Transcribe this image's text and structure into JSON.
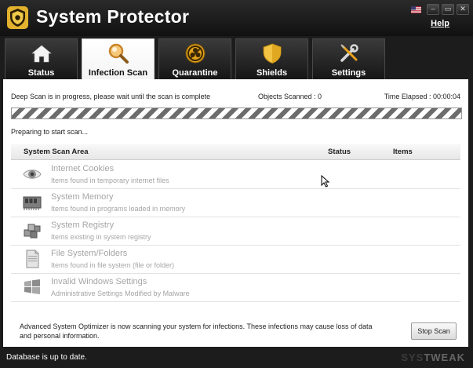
{
  "window": {
    "title": "System Protector",
    "help_label": "Help",
    "buttons": {
      "minimize": "–",
      "restore": "▭",
      "close": "✕"
    },
    "icons": [
      "us-flag-icon",
      "shield-logo-icon"
    ]
  },
  "tabs": [
    {
      "label": "Status",
      "icon": "home-icon",
      "active": false
    },
    {
      "label": "Infection Scan",
      "icon": "magnifier-icon",
      "active": true
    },
    {
      "label": "Quarantine",
      "icon": "biohazard-icon",
      "active": false
    },
    {
      "label": "Shields",
      "icon": "shield-icon",
      "active": false
    },
    {
      "label": "Settings",
      "icon": "tools-icon",
      "active": false
    }
  ],
  "scan": {
    "status_message": "Deep Scan is in progress, please wait until the scan is complete",
    "objects_scanned": "Objects Scanned : 0",
    "time_elapsed": "Time Elapsed : 00:00:04",
    "preparing": "Preparing to start scan..."
  },
  "table": {
    "headers": {
      "area": "System Scan Area",
      "status": "Status",
      "items": "Items"
    },
    "rows": [
      {
        "title": "Internet Cookies",
        "subtitle": "Items found in temporary internet files",
        "icon": "eye-icon"
      },
      {
        "title": "System Memory",
        "subtitle": "Items found in programs loaded in memory",
        "icon": "memory-chip-icon"
      },
      {
        "title": "System Registry",
        "subtitle": "Items existing in system registry",
        "icon": "registry-cubes-icon"
      },
      {
        "title": "File System/Folders",
        "subtitle": "Items found in file system (file or folder)",
        "icon": "document-icon"
      },
      {
        "title": "Invalid Windows Settings",
        "subtitle": "Administrative Settings Modified by Malware",
        "icon": "windows-logo-icon"
      }
    ]
  },
  "footer": {
    "info": "Advanced System Optimizer is now scanning your system for infections. These infections may cause loss of data and personal information.",
    "stop_button": "Stop Scan"
  },
  "statusbar": {
    "text": "Database is up to date.",
    "brand_a": "SYS",
    "brand_b": "TWEAK"
  }
}
